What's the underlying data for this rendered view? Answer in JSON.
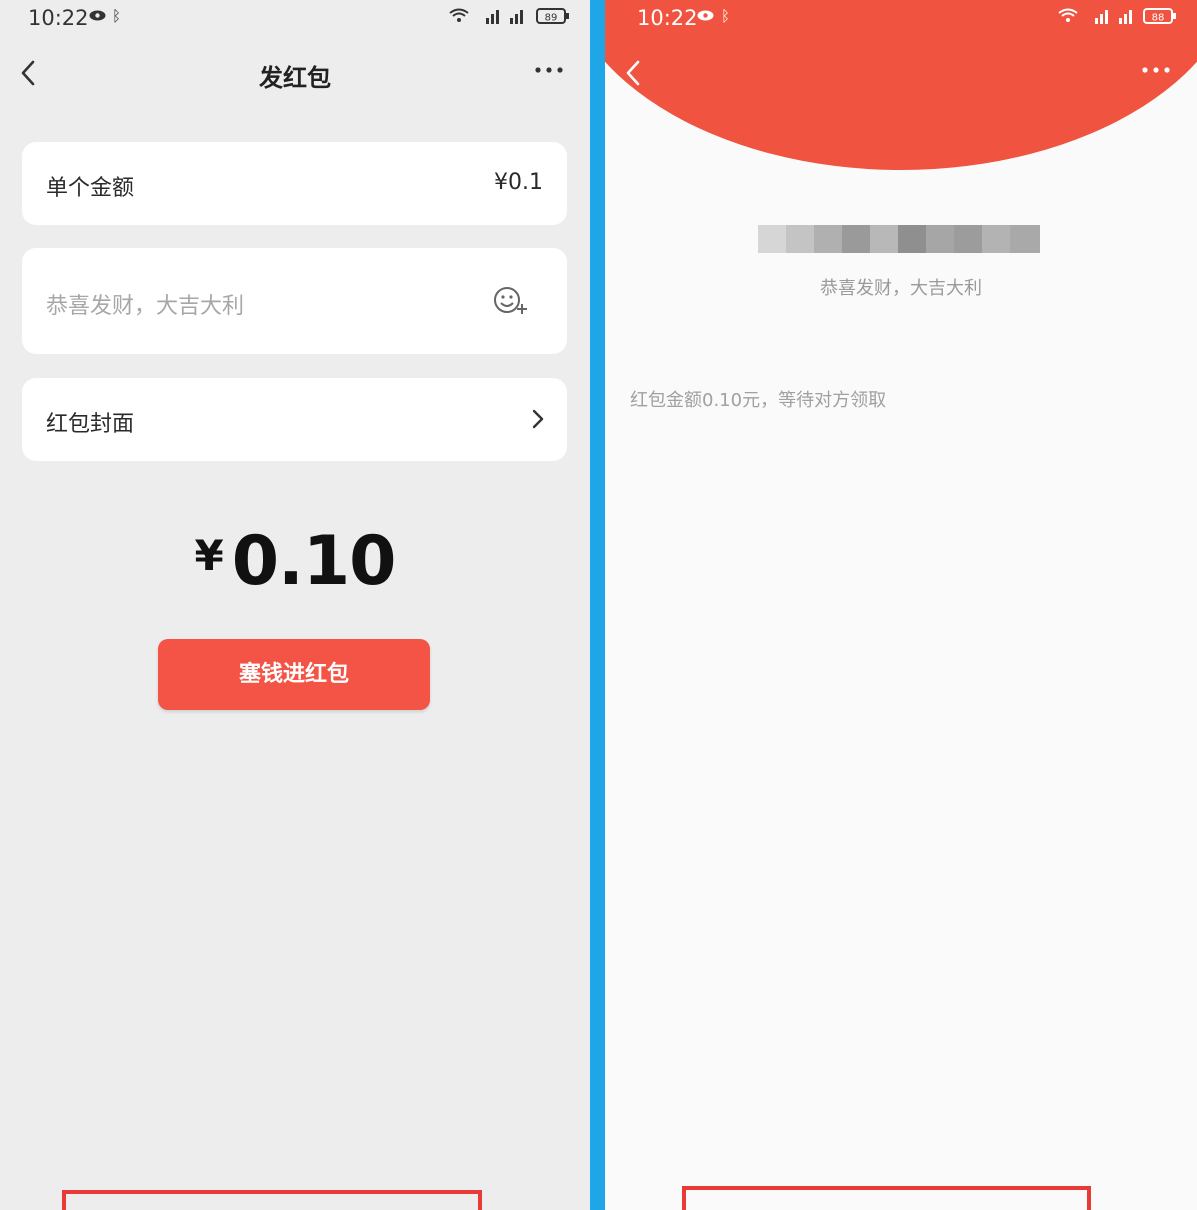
{
  "left": {
    "status": {
      "time": "10:22",
      "battery": "89"
    },
    "nav": {
      "title": "发红包"
    },
    "amount_row": {
      "label": "单个金额",
      "value": "¥0.1"
    },
    "greeting": {
      "placeholder": "恭喜发财，大吉大利"
    },
    "cover_row": {
      "label": "红包封面"
    },
    "total": {
      "symbol": "¥",
      "value": "0.10"
    },
    "send_button": {
      "label": "塞钱进红包"
    }
  },
  "right": {
    "status": {
      "time": "10:22",
      "battery": "88"
    },
    "greeting": "恭喜发财，大吉大利",
    "status_text": "红包金额0.10元，等待对方领取"
  },
  "colors": {
    "accent_red": "#f35446",
    "header_red": "#f05440",
    "highlight_red": "#e83a36",
    "divider_blue": "#1ea6e6"
  },
  "icons": [
    "back-icon",
    "more-icon",
    "emoji-add-icon",
    "chevron-right-icon",
    "eye-icon",
    "bluetooth-icon",
    "wifi-icon",
    "signal-icon",
    "battery-icon"
  ]
}
